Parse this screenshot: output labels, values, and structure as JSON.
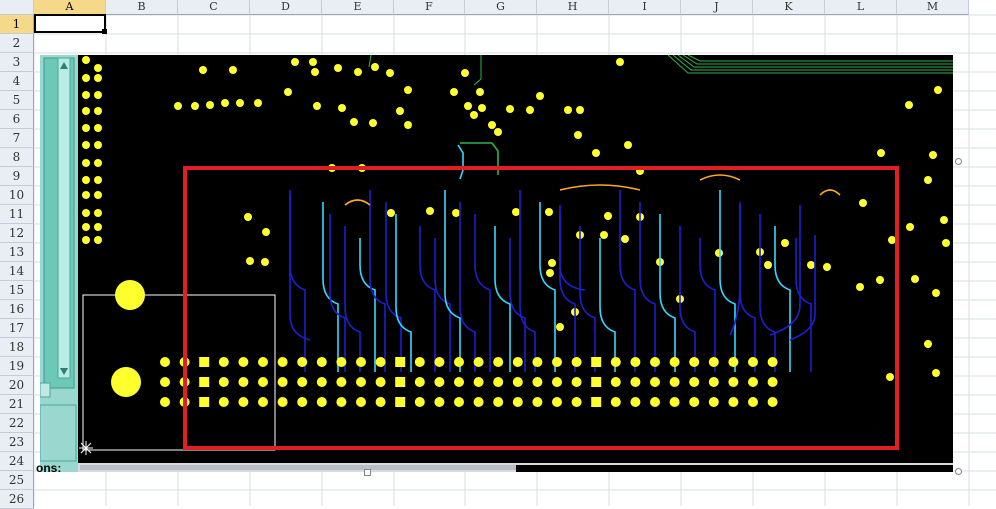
{
  "spreadsheet": {
    "columns": [
      "A",
      "B",
      "C",
      "D",
      "E",
      "F",
      "G",
      "H",
      "I",
      "J",
      "K",
      "L",
      "M"
    ],
    "rows": [
      "1",
      "2",
      "3",
      "4",
      "5",
      "6",
      "7",
      "8",
      "9",
      "10",
      "11",
      "12",
      "13",
      "14",
      "15",
      "16",
      "17",
      "18",
      "19",
      "20",
      "21",
      "22",
      "23",
      "24",
      "25",
      "26"
    ],
    "active_column": "A",
    "active_row": "1"
  },
  "picture": {
    "partial_label": "ons:",
    "highlight_color": "#e02020",
    "board_bg": "#000000",
    "pad_color": "#ffff2e",
    "trace_color": "#1f1fd0",
    "via_trace_color": "#34d8ff",
    "green_trace_color": "#2fb34a"
  }
}
